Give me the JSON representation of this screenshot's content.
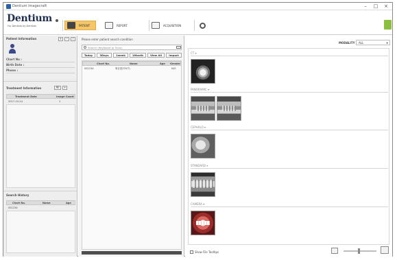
{
  "window": {
    "title": "Dentium Imagecraft",
    "controls": {
      "minimize": "–",
      "maximize": "□",
      "close": "×"
    }
  },
  "header": {
    "logo": "Dentium",
    "tagline": "For Dentists by Dentists",
    "tabs": [
      {
        "label": "PATIENT",
        "icon": "patient-icon",
        "active": true
      },
      {
        "label": "REPORT",
        "icon": "report-icon",
        "active": false
      },
      {
        "label": "ACQUISITION",
        "icon": "acquisition-icon",
        "active": false
      }
    ],
    "settings_icon": "gear-icon",
    "exit_icon": "exit-icon"
  },
  "patient_info": {
    "title": "Patient Information",
    "buttons": [
      "+",
      "−",
      "/"
    ],
    "fields": [
      "Chart No :",
      "Birth Date :",
      "Phone :"
    ]
  },
  "treatment": {
    "title": "Treatment Information",
    "buttons": [
      "All",
      "+"
    ],
    "columns": [
      "Treatment Date",
      "Image Count"
    ],
    "rows": [
      {
        "date": "2017-10-24",
        "count": "1"
      }
    ]
  },
  "search_history": {
    "title": "Search History",
    "columns": [
      "Chart No.",
      "Name",
      "Age"
    ],
    "rows": [
      {
        "chart": "SS1234",
        "name": "",
        "age": ""
      }
    ]
  },
  "search": {
    "hint": "Please enter patient search condition",
    "placeholder": "Search (Keyboard or Scan)",
    "filters": [
      "Today",
      "3Days",
      "1week",
      "1Month",
      "View All",
      "Import"
    ],
    "columns": [
      "Chart No.",
      "Name",
      "Age",
      "Gender"
    ],
    "results": [
      {
        "chart": "SS1234",
        "name": "최신영(TEST)",
        "age": "",
        "gender": "M/S"
      }
    ]
  },
  "viewer": {
    "modality_label": "MODALITY",
    "modality_value": "ALL",
    "sections": [
      {
        "label": "CT",
        "thumbs": 1
      },
      {
        "label": "PANORAMIC",
        "thumbs": 2
      },
      {
        "label": "CEPHALO",
        "thumbs": 1
      },
      {
        "label": "STANDARD",
        "thumbs": 1
      },
      {
        "label": "CAMERA",
        "thumbs": 1
      }
    ],
    "show_file_tooltips": "Show File Tooltips"
  }
}
